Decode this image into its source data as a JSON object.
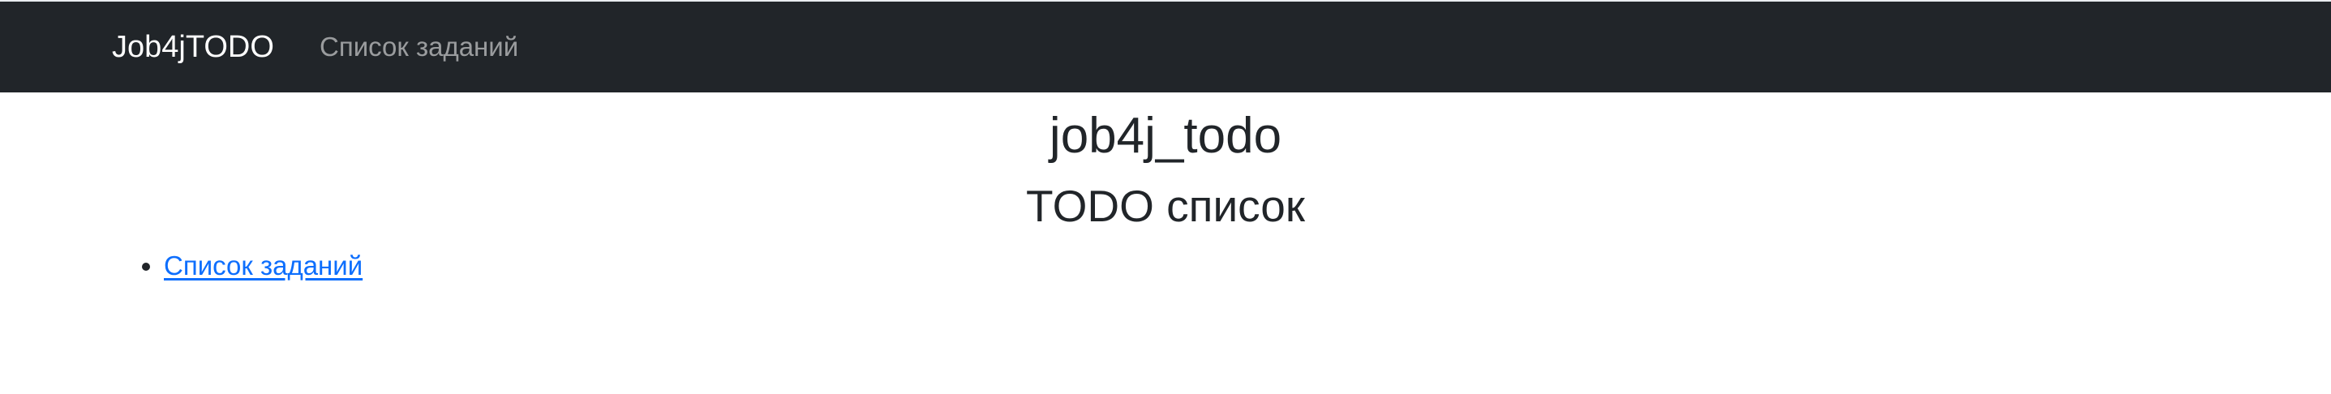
{
  "navbar": {
    "brand": "Job4jTODO",
    "links": [
      {
        "label": "Список заданий"
      }
    ]
  },
  "main": {
    "title": "job4j_todo",
    "subtitle": "TODO список",
    "list": [
      {
        "label": "Список заданий"
      }
    ]
  },
  "colors": {
    "navbar_bg": "#212529",
    "brand_text": "#ffffff",
    "nav_link_text": "#8c8f93",
    "heading_text": "#212529",
    "link": "#0d6efd"
  }
}
